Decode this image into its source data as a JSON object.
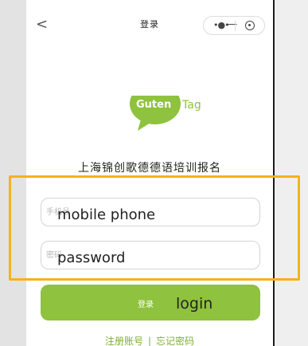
{
  "nav": {
    "back_glyph": "<",
    "title": "登录",
    "capsule": {
      "more_icon": "more-icon",
      "minimize_icon": "minimize-icon",
      "close_icon": "target-icon"
    }
  },
  "logo": {
    "text_left": "Guten",
    "text_right": "Tag",
    "bubble_color": "#8ec23f"
  },
  "school_name": "上海锦创歌德德语培训报名",
  "form": {
    "phone": {
      "placeholder": "手机号",
      "annotation": "mobile phone"
    },
    "password": {
      "placeholder": "密码",
      "annotation": "password"
    },
    "login": {
      "label": "登录",
      "annotation": "login"
    }
  },
  "footer": {
    "register": "注册账号",
    "divider": "|",
    "forgot": "忘记密码"
  },
  "colors": {
    "accent_green": "#8ec23f",
    "highlight": "#f7b11c"
  }
}
